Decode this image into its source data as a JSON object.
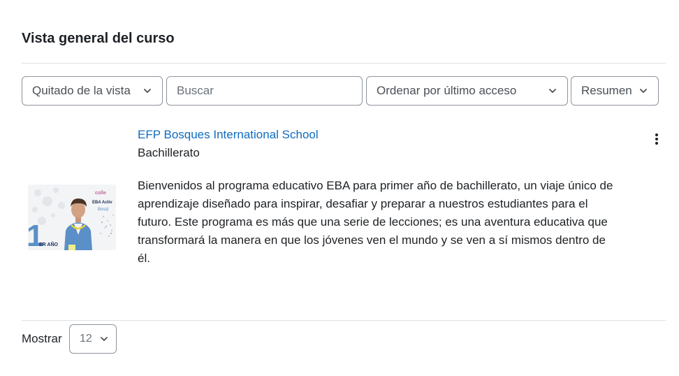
{
  "page_title": "Vista general del curso",
  "filters": {
    "grouping": {
      "value": "Quitado de la vista",
      "icon": "chevron-down-icon"
    },
    "search": {
      "placeholder": "Buscar",
      "value": ""
    },
    "sort": {
      "value": "Ordenar por último acceso",
      "icon": "chevron-down-icon"
    },
    "view": {
      "value": "Resumen",
      "icon": "chevron-down-icon"
    }
  },
  "course": {
    "name": "EFP Bosques International School",
    "category": "Bachillerato",
    "summary": "Bienvenidos al programa educativo EBA para primer año de bachillerato, un viaje único de aprendizaje diseñado para inspirar, desafiar y preparar a nuestros estudiantes para el futuro. Este programa es más que una serie de lecciones; es una aventura educativa que transformará la manera en que los jóvenes ven el mundo y se ven a sí mismos dentro de él.",
    "thumbnail": {
      "big_number": "1",
      "caption": "ER AÑO",
      "logo_line1": "colle",
      "logo_line2": "EBA Activ",
      "logo_line3": "Bosql"
    },
    "actions_icon": "kebab-menu-icon"
  },
  "pagination": {
    "label": "Mostrar",
    "value": "12"
  },
  "colors": {
    "link": "#0f6cbf",
    "text": "#1d2125",
    "border": "#8f959e",
    "thumbnail_accent": "#5b8fc7"
  }
}
